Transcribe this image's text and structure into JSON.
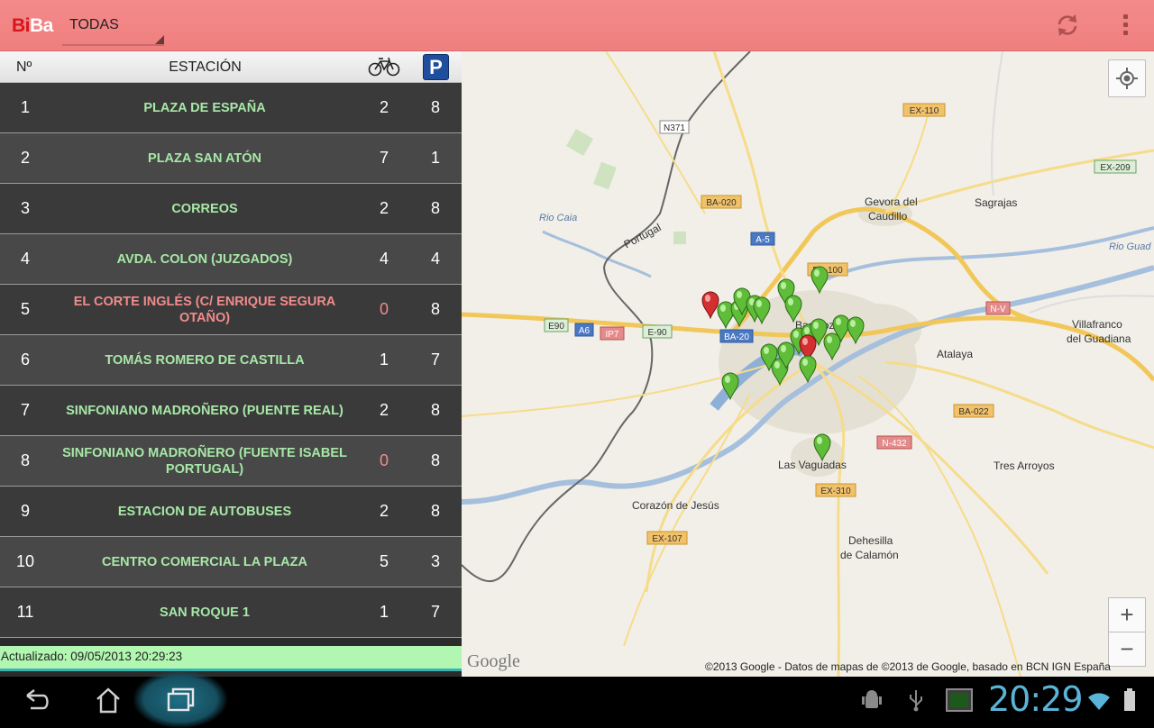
{
  "app": {
    "logo_part1": "Bi",
    "logo_part2": "Ba",
    "filter_value": "TODAS",
    "accent_color": "#f07f7f"
  },
  "icons": {
    "refresh": "refresh-icon",
    "overflow": "overflow-menu-icon",
    "bike": "bicycle-icon",
    "parking": "parking-icon",
    "locate": "my-location-icon",
    "back": "back-icon",
    "home": "home-icon",
    "recents": "recent-apps-icon"
  },
  "list": {
    "header": {
      "number": "Nº",
      "station": "ESTACIÓN",
      "parking_letter": "P"
    },
    "rows": [
      {
        "num": "1",
        "name": "PLAZA DE ESPAÑA",
        "bikes": "2",
        "slots": "8",
        "alert": false
      },
      {
        "num": "2",
        "name": "PLAZA SAN ATÓN",
        "bikes": "7",
        "slots": "1",
        "alert": false
      },
      {
        "num": "3",
        "name": "CORREOS",
        "bikes": "2",
        "slots": "8",
        "alert": false
      },
      {
        "num": "4",
        "name": "AVDA. COLON (JUZGADOS)",
        "bikes": "4",
        "slots": "4",
        "alert": false
      },
      {
        "num": "5",
        "name": "EL CORTE INGLÉS (C/ ENRIQUE SEGURA OTAÑO)",
        "bikes": "0",
        "slots": "8",
        "alert": true
      },
      {
        "num": "6",
        "name": "TOMÁS ROMERO DE CASTILLA",
        "bikes": "1",
        "slots": "7",
        "alert": false
      },
      {
        "num": "7",
        "name": "SINFONIANO MADROÑERO (PUENTE REAL)",
        "bikes": "2",
        "slots": "8",
        "alert": false
      },
      {
        "num": "8",
        "name": "SINFONIANO MADROÑERO (FUENTE ISABEL PORTUGAL)",
        "bikes": "0",
        "slots": "8",
        "alert": false
      },
      {
        "num": "9",
        "name": "ESTACION DE AUTOBUSES",
        "bikes": "2",
        "slots": "8",
        "alert": false
      },
      {
        "num": "10",
        "name": "CENTRO COMERCIAL LA PLAZA",
        "bikes": "5",
        "slots": "3",
        "alert": false
      },
      {
        "num": "11",
        "name": "SAN ROQUE 1",
        "bikes": "1",
        "slots": "7",
        "alert": false
      }
    ],
    "updated": "Actualizado: 09/05/2013 20:29:23"
  },
  "map": {
    "places": [
      "Gevora del",
      "Caudillo",
      "Sagrajas",
      "Villafranco",
      "del Guadiana",
      "Atalaya",
      "Las Vaguadas",
      "Tres Arroyos",
      "Corazón de Jesús",
      "Dehesilla",
      "de Calamón",
      "Portugal",
      "Badajoz"
    ],
    "water": [
      "Rio Caia",
      "Rio Guad"
    ],
    "roads": [
      "N371",
      "EX-110",
      "EX-209",
      "BA-020",
      "A-5",
      "BA-100",
      "N-V",
      "E90",
      "A6",
      "IP7",
      "E-90",
      "BA-20",
      "BA-022",
      "N-432",
      "EX-310",
      "EX-107"
    ],
    "zoom_in": "+",
    "zoom_out": "−",
    "google": "Google",
    "copyright": "©2013 Google - Datos de mapas de ©2013 de Google, basado en BCN IGN España"
  },
  "system": {
    "clock": "20:29"
  }
}
